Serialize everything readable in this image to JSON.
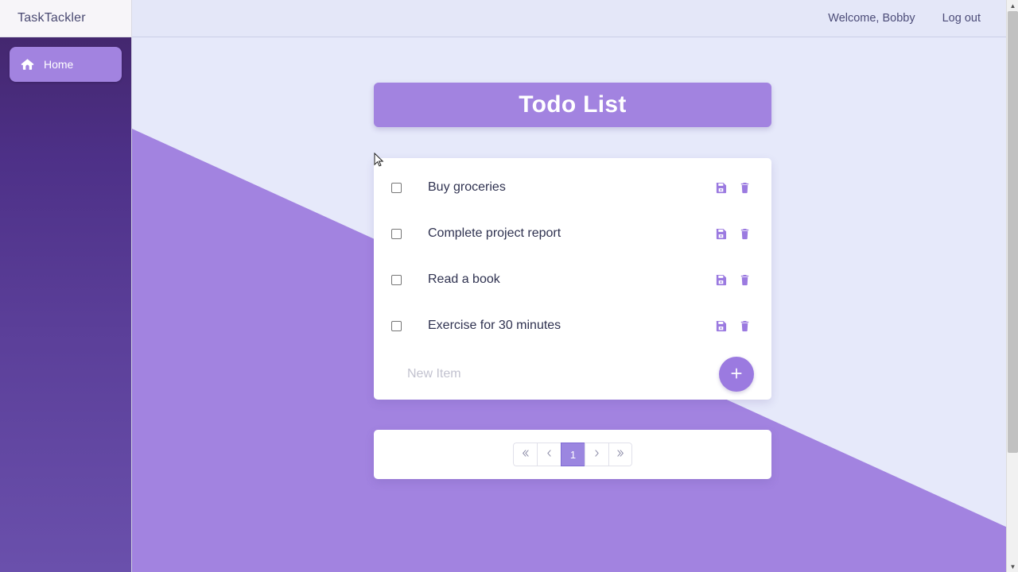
{
  "app": {
    "brand": "TaskTackler",
    "accent": "#a283e0",
    "sidebar_top": "#44276f",
    "sidebar_bottom": "#6a50ac",
    "background": "#e6e9fa"
  },
  "sidebar": {
    "items": [
      {
        "label": "Home",
        "icon": "home-icon",
        "active": true
      }
    ]
  },
  "topbar": {
    "welcome": "Welcome, Bobby",
    "logout": "Log out"
  },
  "main": {
    "title": "Todo List",
    "todos": [
      {
        "text": "Buy groceries",
        "checked": false,
        "save_icon": "save-icon",
        "delete_icon": "trash-icon"
      },
      {
        "text": "Complete project report",
        "checked": false,
        "save_icon": "save-icon",
        "delete_icon": "trash-icon"
      },
      {
        "text": "Read a book",
        "checked": false,
        "save_icon": "save-icon",
        "delete_icon": "trash-icon"
      },
      {
        "text": "Exercise for 30 minutes",
        "checked": false,
        "save_icon": "save-icon",
        "delete_icon": "trash-icon"
      }
    ],
    "new_item": {
      "value": "",
      "placeholder": "New Item",
      "add_icon": "plus-icon"
    },
    "pagination": {
      "first_icon": "double-chevron-left-icon",
      "prev_icon": "chevron-left-icon",
      "pages": [
        "1"
      ],
      "current_page": "1",
      "next_icon": "chevron-right-icon",
      "last_icon": "double-chevron-right-icon"
    }
  }
}
